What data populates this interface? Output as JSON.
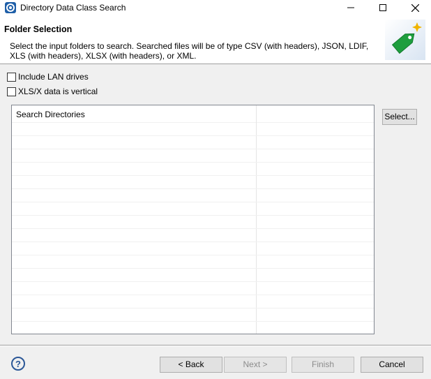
{
  "window": {
    "title": "Directory Data Class Search",
    "minimize_glyph": "—",
    "maximize_glyph": "☐",
    "close_glyph": "✕"
  },
  "banner": {
    "title": "Folder Selection",
    "description": "Select the input folders to search. Searched files will be of type CSV (with headers), JSON, LDIF, XLS (with headers), XLSX (with headers), or XML.",
    "icon": "green-tag-icon"
  },
  "options": [
    {
      "label": "Include LAN drives",
      "checked": false
    },
    {
      "label": "XLS/X data is vertical",
      "checked": false
    }
  ],
  "table": {
    "columns": [
      "Search Directories",
      ""
    ],
    "rows": []
  },
  "buttons": {
    "select": "Select...",
    "back": "< Back",
    "next": "Next >",
    "finish": "Finish",
    "cancel": "Cancel",
    "help": "?"
  },
  "colors": {
    "accent": "#0078d7",
    "tag_green": "#1e9e3e",
    "help_blue": "#2b5797"
  }
}
